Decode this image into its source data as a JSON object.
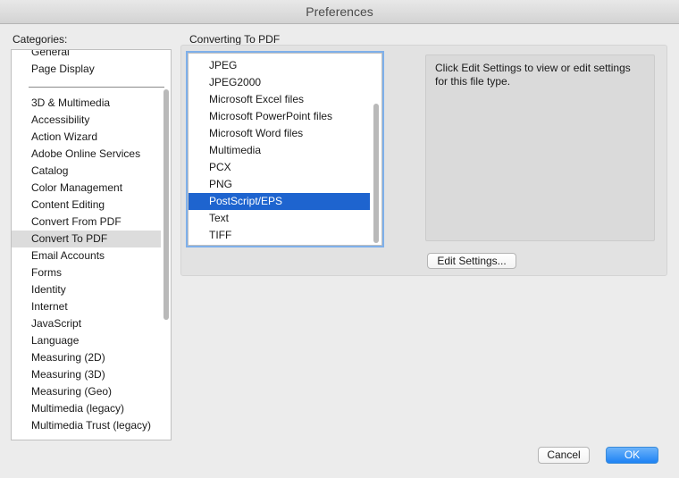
{
  "window": {
    "title": "Preferences"
  },
  "categories": {
    "label": "Categories:",
    "top_items": [
      "General",
      "Page Display"
    ],
    "items": [
      "3D & Multimedia",
      "Accessibility",
      "Action Wizard",
      "Adobe Online Services",
      "Catalog",
      "Color Management",
      "Content Editing",
      "Convert From PDF",
      "Convert To PDF",
      "Email Accounts",
      "Forms",
      "Identity",
      "Internet",
      "JavaScript",
      "Language",
      "Measuring (2D)",
      "Measuring (3D)",
      "Measuring (Geo)",
      "Multimedia (legacy)",
      "Multimedia Trust (legacy)"
    ],
    "selected": "Convert To PDF"
  },
  "convert": {
    "section_label": "Converting To PDF",
    "file_types": [
      "JPEG",
      "JPEG2000",
      "Microsoft Excel files",
      "Microsoft PowerPoint files",
      "Microsoft Word files",
      "Multimedia",
      "PCX",
      "PNG",
      "PostScript/EPS",
      "Text",
      "TIFF"
    ],
    "selected": "PostScript/EPS",
    "info_text": "Click Edit Settings to view or edit settings for this file type.",
    "edit_settings_label": "Edit Settings..."
  },
  "footer": {
    "cancel_label": "Cancel",
    "ok_label": "OK"
  }
}
